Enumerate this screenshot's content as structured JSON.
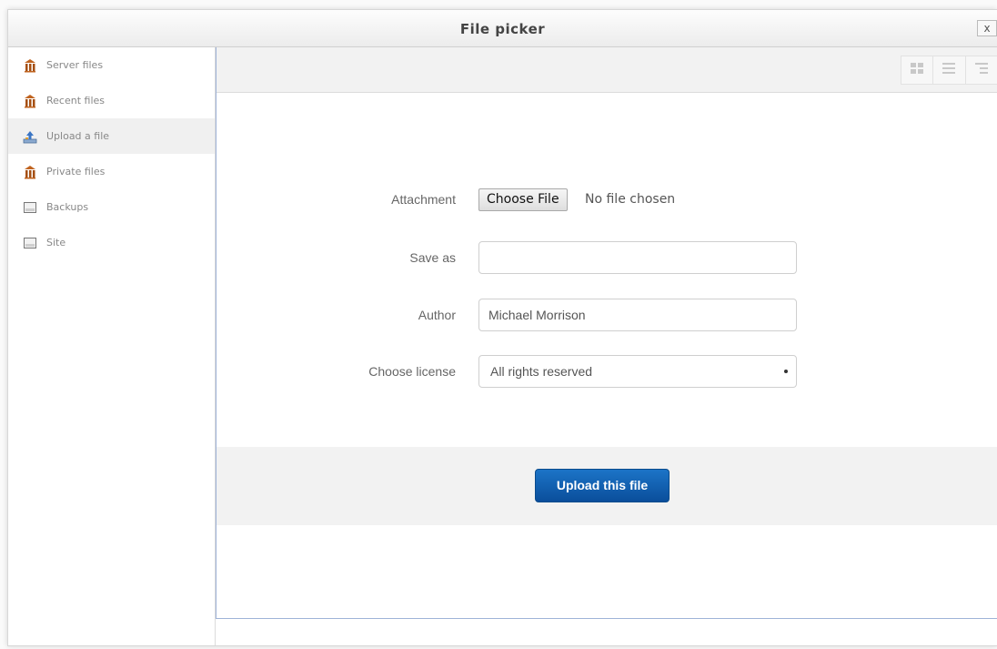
{
  "dialog": {
    "title": "File picker",
    "close_label": "x"
  },
  "sidebar": {
    "items": [
      {
        "label": "Server files",
        "icon": "repository-server-icon",
        "active": false
      },
      {
        "label": "Recent files",
        "icon": "repository-recent-icon",
        "active": false
      },
      {
        "label": "Upload a file",
        "icon": "repository-upload-icon",
        "active": true
      },
      {
        "label": "Private files",
        "icon": "repository-private-icon",
        "active": false
      },
      {
        "label": "Backups",
        "icon": "repository-backups-icon",
        "active": false
      },
      {
        "label": "Site",
        "icon": "repository-site-icon",
        "active": false
      }
    ]
  },
  "toolbar": {
    "views": [
      "icons-view-icon",
      "list-view-icon",
      "tree-view-icon"
    ]
  },
  "form": {
    "attachment_label": "Attachment",
    "choose_file_label": "Choose File",
    "file_status": "No file chosen",
    "saveas_label": "Save as",
    "saveas_value": "",
    "author_label": "Author",
    "author_value": "Michael Morrison",
    "license_label": "Choose license",
    "license_value": "All rights reserved",
    "upload_button_label": "Upload this file"
  },
  "colors": {
    "upload_button": "#0f5fb0",
    "main_border": "#9fb3d8",
    "active_item_bg": "#f0f0f0",
    "repo_icon": "#b85a1a"
  }
}
